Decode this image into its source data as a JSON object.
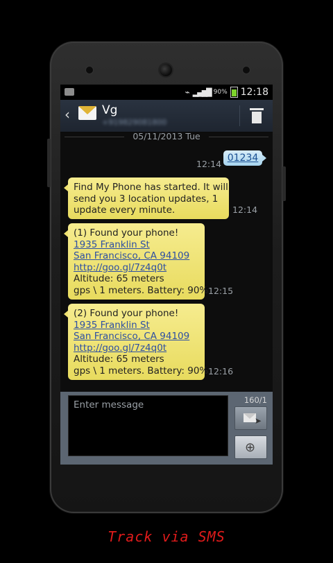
{
  "status_bar": {
    "battery_pct": "90%",
    "time": "12:18"
  },
  "header": {
    "contact_name": "Vg",
    "contact_number": "+919829081800",
    "back_icon": "chevron-left-icon",
    "delete_icon": "trash-icon"
  },
  "thread": {
    "date": "05/11/2013 Tue",
    "outgoing": {
      "text": "01234",
      "time": "12:14"
    },
    "incoming": [
      {
        "lines": [
          "Find My Phone has started. It will",
          "send you 3 location updates, 1",
          "update every minute."
        ],
        "time": "12:14"
      },
      {
        "lines": [
          "(1) Found your phone!",
          "1935 Franklin St",
          "San Francisco, CA 94109",
          "http://goo.gl/7z4q0t",
          "Altitude: 65 meters",
          "gps \\ 1 meters. Battery: 90%."
        ],
        "time": "12:15"
      },
      {
        "lines": [
          "(2) Found your phone!",
          "1935 Franklin St",
          "San Francisco, CA 94109",
          "http://goo.gl/7z4q0t",
          "Altitude: 65 meters",
          "gps \\ 1 meters. Battery: 90%."
        ],
        "time": "12:16"
      }
    ]
  },
  "compose": {
    "placeholder": "Enter message",
    "counter": "160/1",
    "send_icon": "send-message-icon",
    "attach_icon": "paperclip-icon"
  },
  "caption": "Track via SMS"
}
